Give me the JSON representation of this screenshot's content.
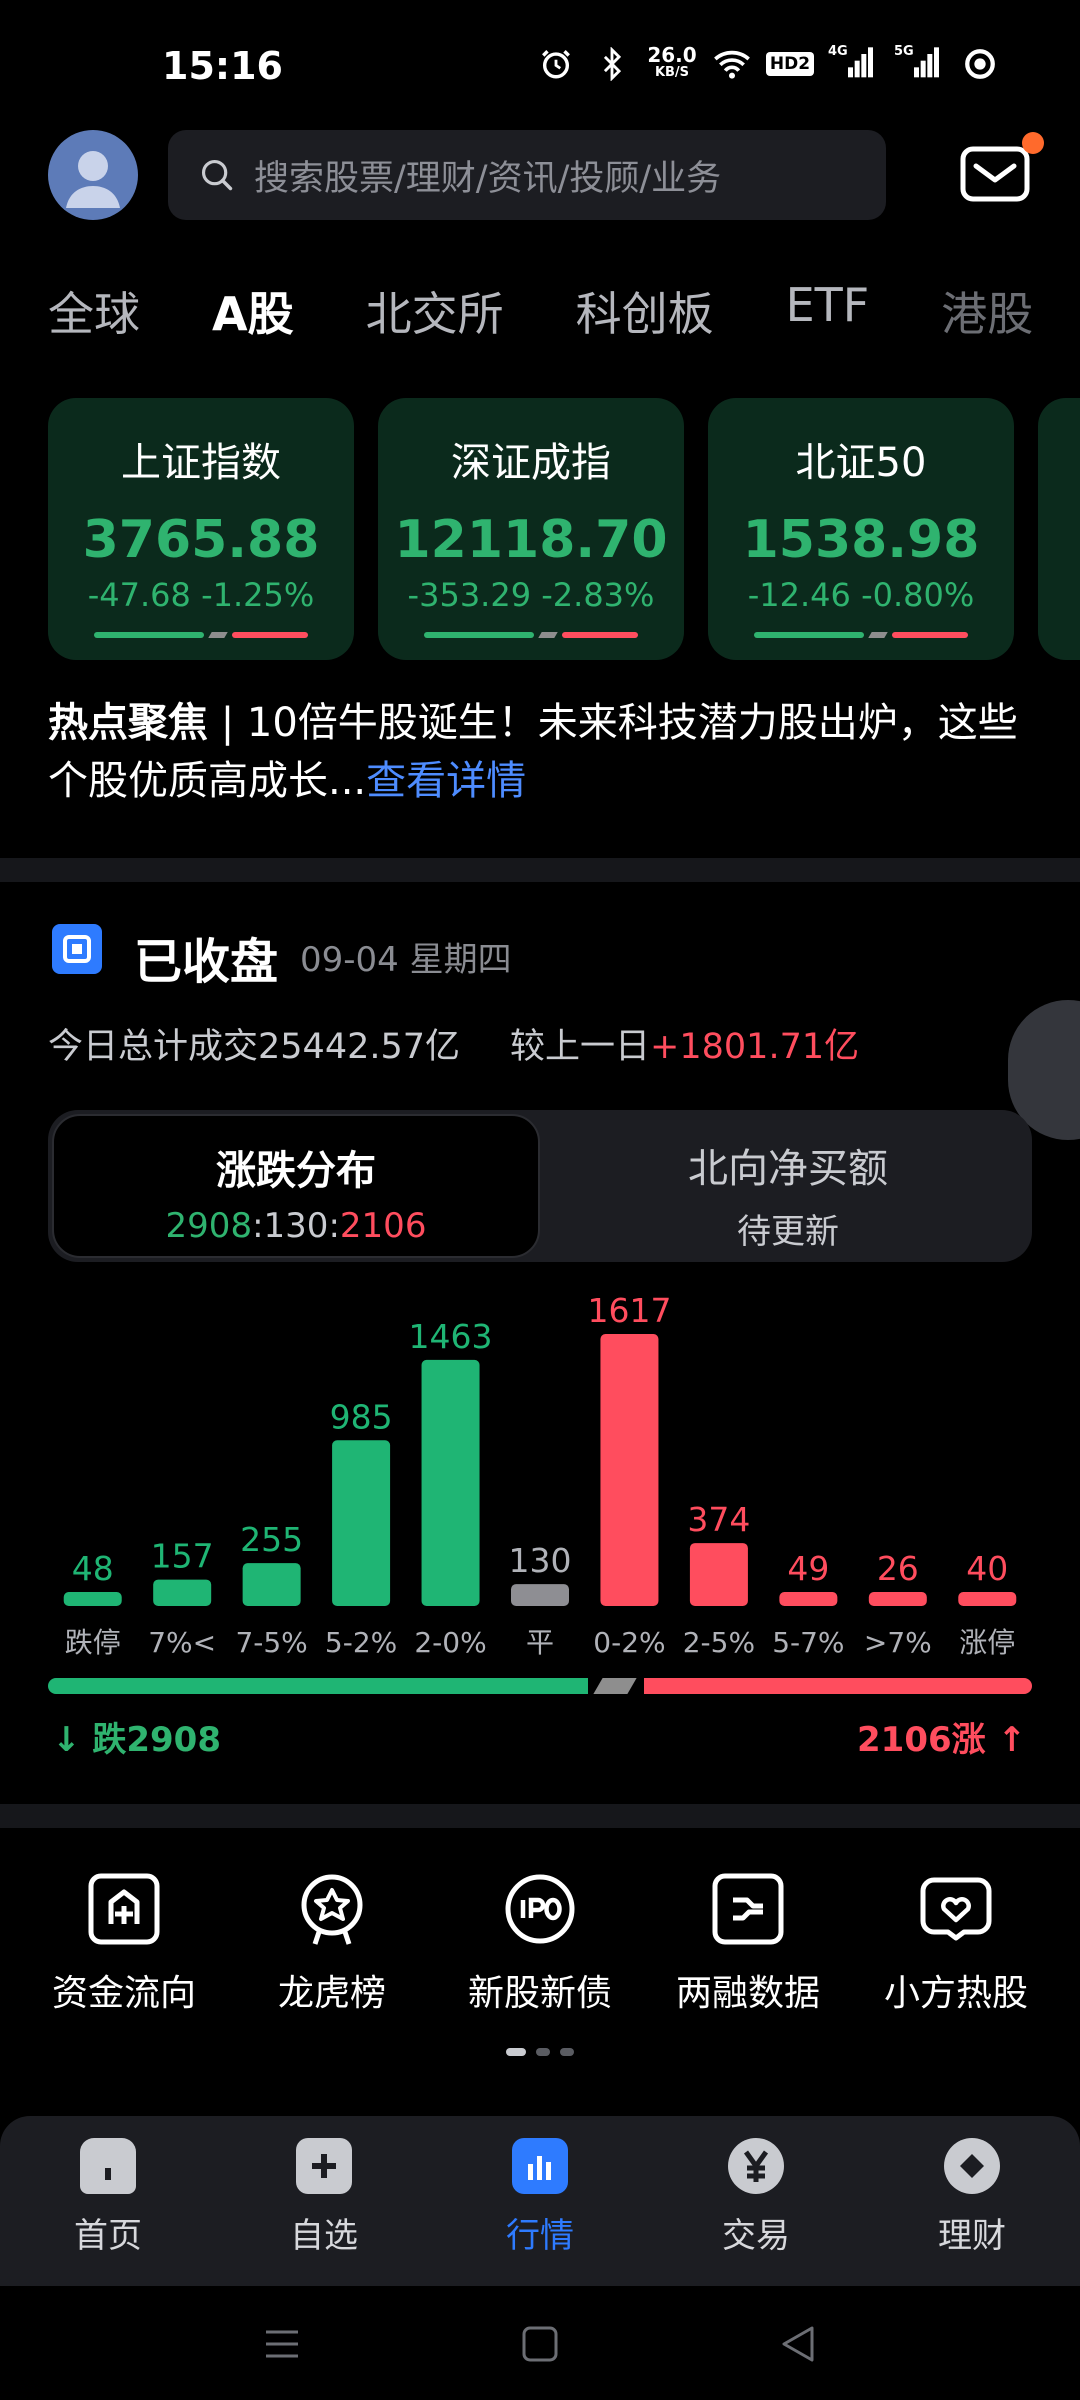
{
  "status_bar": {
    "time": "15:16",
    "speed_value": "26.0",
    "speed_unit": "KB/S",
    "hd_label": "HD2",
    "net1": "4G",
    "net2": "5G"
  },
  "search": {
    "placeholder": "搜索股票/理财/资讯/投顾/业务"
  },
  "tabs": [
    "全球",
    "A股",
    "北交所",
    "科创板",
    "ETF",
    "港股"
  ],
  "active_tab": "A股",
  "index_cards": [
    {
      "name": "上证指数",
      "value": "3765.88",
      "change": "-47.68 -1.25%"
    },
    {
      "name": "深证成指",
      "value": "12118.70",
      "change": "-353.29 -2.83%"
    },
    {
      "name": "北证50",
      "value": "1538.98",
      "change": "-12.46 -0.80%"
    }
  ],
  "hot_news": {
    "tag": "热点聚焦",
    "separator": " | ",
    "text": "10倍牛股诞生！未来科技潜力股出炉，这些个股优质高成长...",
    "link": "查看详情"
  },
  "market_close": {
    "title": "已收盘",
    "date": "09-04 星期四",
    "turnover_label": "今日总计成交",
    "turnover_value": "25442.57亿",
    "compare_label": "较上一日",
    "compare_value": "+1801.71亿"
  },
  "segment": {
    "active": {
      "title": "涨跌分布",
      "fall": "2908",
      "sep": ":",
      "flat": "130",
      "rise": "2106"
    },
    "other": {
      "title": "北向净买额",
      "subtitle": "待更新"
    }
  },
  "chart_data": {
    "type": "bar",
    "categories": [
      "跌停",
      "7%<",
      "7-5%",
      "5-2%",
      "2-0%",
      "平",
      "0-2%",
      "2-5%",
      "5-7%",
      ">7%",
      "涨停"
    ],
    "values": [
      48,
      157,
      255,
      985,
      1463,
      130,
      1617,
      374,
      49,
      26,
      40
    ],
    "colors": [
      "#1fb574",
      "#1fb574",
      "#1fb574",
      "#1fb574",
      "#1fb574",
      "#8e8e93",
      "#ff4d5e",
      "#ff4d5e",
      "#ff4d5e",
      "#ff4d5e",
      "#ff4d5e"
    ],
    "ylim": [
      0,
      1617
    ]
  },
  "distribution": {
    "fall_label": "跌2908",
    "rise_label": "2106涨",
    "fall_arrow": "↓",
    "rise_arrow": "↑"
  },
  "quick_entries": [
    {
      "label": "资金流向",
      "icon": "fund-flow-icon"
    },
    {
      "label": "龙虎榜",
      "icon": "dragon-tiger-icon"
    },
    {
      "label": "新股新债",
      "icon": "ipo-icon"
    },
    {
      "label": "两融数据",
      "icon": "margin-data-icon"
    },
    {
      "label": "小方热股",
      "icon": "hot-stock-icon"
    }
  ],
  "bottom_nav": [
    {
      "label": "首页",
      "icon": "home-icon"
    },
    {
      "label": "自选",
      "icon": "watchlist-icon"
    },
    {
      "label": "行情",
      "icon": "market-icon"
    },
    {
      "label": "交易",
      "icon": "trade-icon"
    },
    {
      "label": "理财",
      "icon": "wealth-icon"
    }
  ],
  "colors": {
    "up": "#ff4d5e",
    "down": "#1fb574",
    "accent": "#2e7bff",
    "link": "#4e8cff"
  }
}
